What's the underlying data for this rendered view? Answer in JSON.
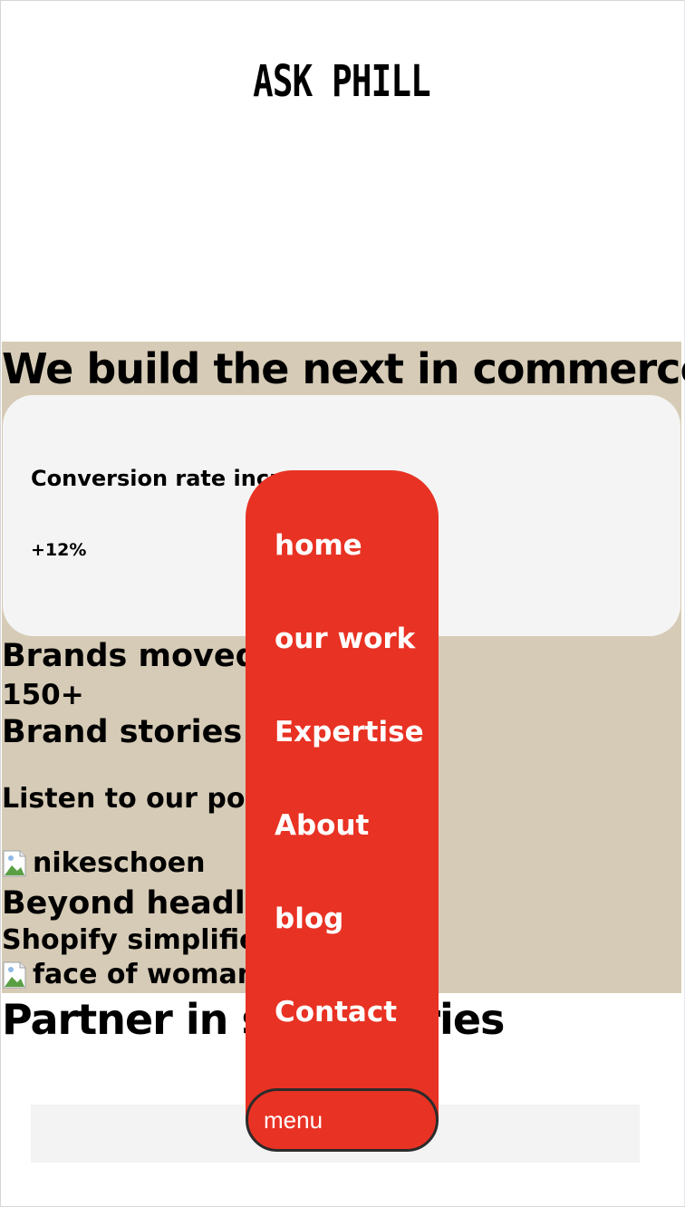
{
  "brand": {
    "logo_text": "ASK PHILL"
  },
  "hero": {
    "title": "We build the next in commerce"
  },
  "stat_card": {
    "label": "Conversion rate incre",
    "value": "+12%"
  },
  "brands": {
    "moved_text": "Brands moved",
    "count": "150+",
    "stories_text": "Brand stories"
  },
  "podcast": {
    "text": "Listen to our podc"
  },
  "stories": {
    "image_alt_1": "nikeschoen",
    "headline_1": "Beyond headle",
    "headline_2": "Shopify simplified",
    "image_alt_2": "face of woman"
  },
  "partner": {
    "title": "Partner in s",
    "title_tail": "ories"
  },
  "menu": {
    "items": [
      "home",
      "our work",
      "Expertise",
      "About",
      "blog",
      "Contact"
    ],
    "toggle_label": "menu"
  },
  "colors": {
    "accent": "#e83223",
    "beige": "#d6cbb6",
    "card": "#f4f4f4"
  }
}
